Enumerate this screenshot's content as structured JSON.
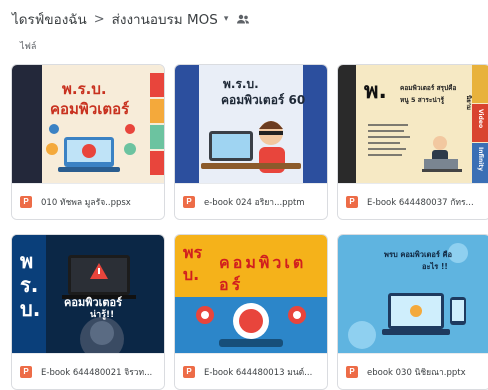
{
  "breadcrumb": {
    "root": "ไดรฟ์ของฉัน",
    "separator": ">",
    "folder": "ส่งงานอบรม MOS",
    "caret": "▾"
  },
  "section_label": "ไฟล์",
  "file_type_icon": "P",
  "accent_powerpoint": "#ed6c47",
  "files": [
    {
      "name": "010 ทัชพล มูลรัจ..ppsx",
      "thumb_title_1": "พ.ร.บ.",
      "thumb_title_2": "คอมพิวเตอร์"
    },
    {
      "name": "e-book 024 อริยา...pptm",
      "thumb_title_1": "พ.ร.บ.",
      "thumb_title_2": "คอมพิวเตอร์ 60"
    },
    {
      "name": "E-book 644480037 กัทร...",
      "thumb_title_1": "พ.",
      "thumb_title_2": "คอมพิวเตอร์ สรุปคือ",
      "thumb_title_3": "หนู 5 สาระน่ารู้",
      "thumb_tab_1": "นิยาม",
      "thumb_tab_2": "Video",
      "thumb_tab_3": "Infinity"
    },
    {
      "name": "E-book 644480021 จิรวท...",
      "thumb_title_1": "พ",
      "thumb_title_2": "ร.",
      "thumb_title_3": "บ.",
      "thumb_title_4": "คอมพิวเตอร์",
      "thumb_title_5": "น่ารู้!!"
    },
    {
      "name": "E-book 644480013 มนต์...",
      "thumb_title_1": "พร",
      "thumb_title_2": "คอมพิวเต",
      "thumb_title_3": "บ.",
      "thumb_title_4": "อร์"
    },
    {
      "name": "ebook 030 นิชิยณา.pptx",
      "thumb_title_1": "พรบ คอมพิวเตอร์ คือ",
      "thumb_title_2": "อะไร !!"
    }
  ]
}
